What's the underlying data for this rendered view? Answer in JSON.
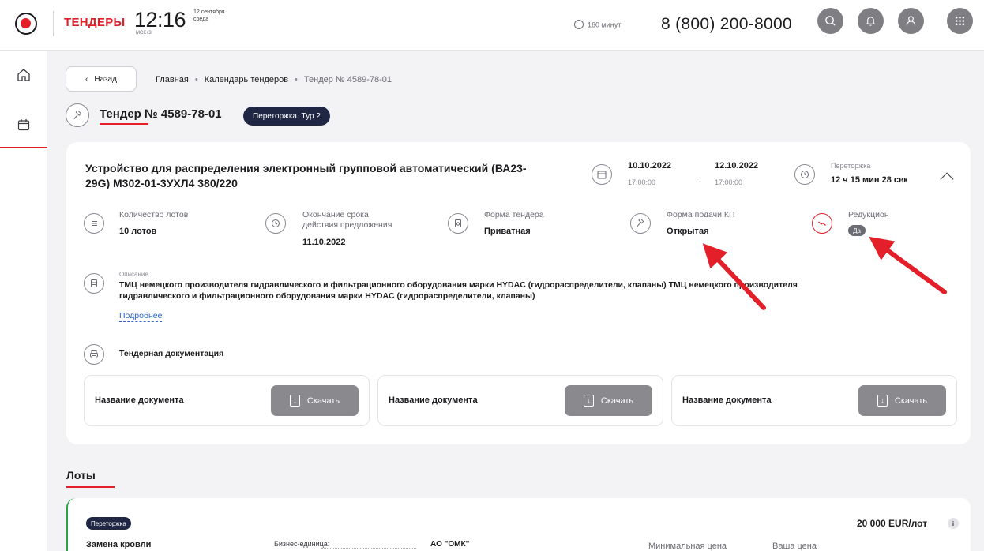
{
  "header": {
    "brand": "ТЕНДЕРЫ",
    "time": "12:16",
    "timezone": "МСК+3",
    "date_line1": "12 сентября",
    "date_line2": "среда",
    "time_left": "160 минут",
    "phone": "8 (800) 200-8000",
    "icons": [
      "search-icon",
      "bell-icon",
      "user-icon",
      "apps-icon"
    ]
  },
  "sidebar": {
    "items": [
      "home-icon",
      "calendar-icon"
    ]
  },
  "nav": {
    "back_label": "Назад",
    "breadcrumbs": [
      "Главная",
      "Календарь тендеров",
      "Тендер № 4589-78-01"
    ]
  },
  "tender": {
    "title": "Тендер № 4589-78-01",
    "stage_badge": "Переторжка. Тур 2",
    "product": "Устройство для распределения электронный групповой автоматический (ВА23-29G) М302-01-3УХЛ4 380/220",
    "date_start": "10.10.2022",
    "time_start": "17:00:00",
    "date_end": "12.10.2022",
    "time_end": "17:00:00",
    "retender_label": "Переторжка",
    "retender_value": "12 ч 15 мин 28 сек",
    "info": {
      "lots_label": "Количество лотов",
      "lots_value": "10 лотов",
      "deadline_label_1": "Окончание срока",
      "deadline_label_2": "действия предложения",
      "deadline_value": "11.10.2022",
      "form_label": "Форма тендера",
      "form_value": "Приватная",
      "submit_label": "Форма подачи КП",
      "submit_value": "Открытая",
      "reduction_label": "Редукцион",
      "reduction_value": "Да"
    },
    "description_label": "Описание",
    "description_line1": "ТМЦ немецкого производителя гидравлического и фильтрационного оборудования марки HYDAC (гидрораспределители, клапаны) ТМЦ немецкого производителя",
    "description_line2": "гидравлического и фильтрационного оборудования марки HYDAC (гидрораспределители, клапаны)",
    "more_link": "Подробнее",
    "docs_title": "Тендерная документация",
    "documents": [
      {
        "name": "Название документа",
        "button": "Скачать"
      },
      {
        "name": "Название документа",
        "button": "Скачать"
      },
      {
        "name": "Название документа",
        "button": "Скачать"
      }
    ]
  },
  "lots": {
    "title": "Лоты",
    "items": [
      {
        "badge": "Переторжка",
        "name": "Замена кровли",
        "bu_label": "Бизнес-единица:",
        "bu_value": "АО \"ОМК\"",
        "price": "20 000 EUR/лот",
        "min_price_label": "Минимальная цена",
        "your_price_label": "Ваша цена"
      }
    ]
  },
  "colors": {
    "accent": "#e3202a",
    "badge": "#1f2744",
    "button": "#8a8a8e",
    "link": "#2f63c7",
    "lot_border": "#2ba14a"
  }
}
